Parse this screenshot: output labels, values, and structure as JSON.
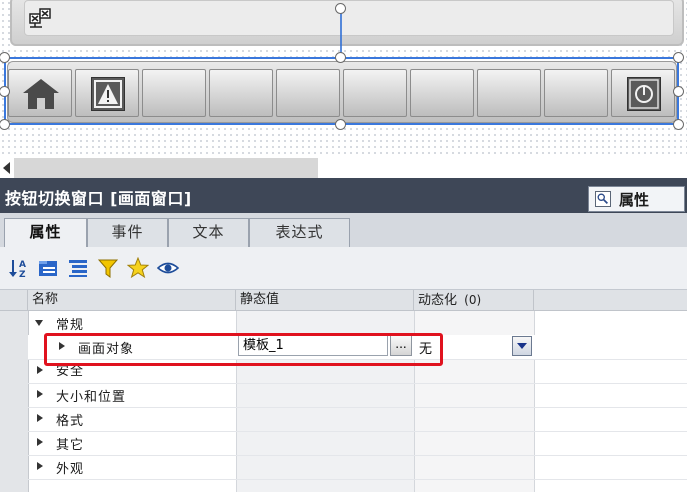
{
  "editor": {
    "screen_buttons": [
      {
        "name": "home-icon"
      },
      {
        "name": "warning-icon"
      },
      {
        "name": "empty"
      },
      {
        "name": "empty"
      },
      {
        "name": "empty"
      },
      {
        "name": "empty"
      },
      {
        "name": "empty"
      },
      {
        "name": "empty"
      },
      {
        "name": "empty"
      },
      {
        "name": "power-icon"
      }
    ]
  },
  "inspector": {
    "title": "按钮切换窗口 [画面窗口]",
    "properties_tab_label": "属性",
    "tabs": [
      "属性",
      "事件",
      "文本",
      "表达式"
    ],
    "active_tab": "属性",
    "toolbar_icons": [
      "sort-az-icon",
      "show-categories-icon",
      "show-list-icon",
      "filter-icon",
      "favorites-star-icon",
      "eye-icon"
    ]
  },
  "grid": {
    "columns": {
      "name": "名称",
      "static": "静态值",
      "dynamic": "动态化",
      "dynamic_count": "(0)"
    },
    "rows": [
      {
        "label": "常规",
        "expanded": true,
        "level": 0
      },
      {
        "label": "画面对象",
        "expanded": false,
        "level": 1,
        "static_value": "模板_1",
        "ellipsis": "...",
        "dynamic": "无"
      },
      {
        "label": "安全",
        "expanded": false,
        "level": 0
      },
      {
        "label": "大小和位置",
        "expanded": false,
        "level": 0
      },
      {
        "label": "格式",
        "expanded": false,
        "level": 0
      },
      {
        "label": "其它",
        "expanded": false,
        "level": 0
      },
      {
        "label": "外观",
        "expanded": false,
        "level": 0
      }
    ]
  },
  "colors": {
    "titlebar": "#3e4757",
    "highlight": "#e0121e",
    "selection": "#3b78dc"
  }
}
